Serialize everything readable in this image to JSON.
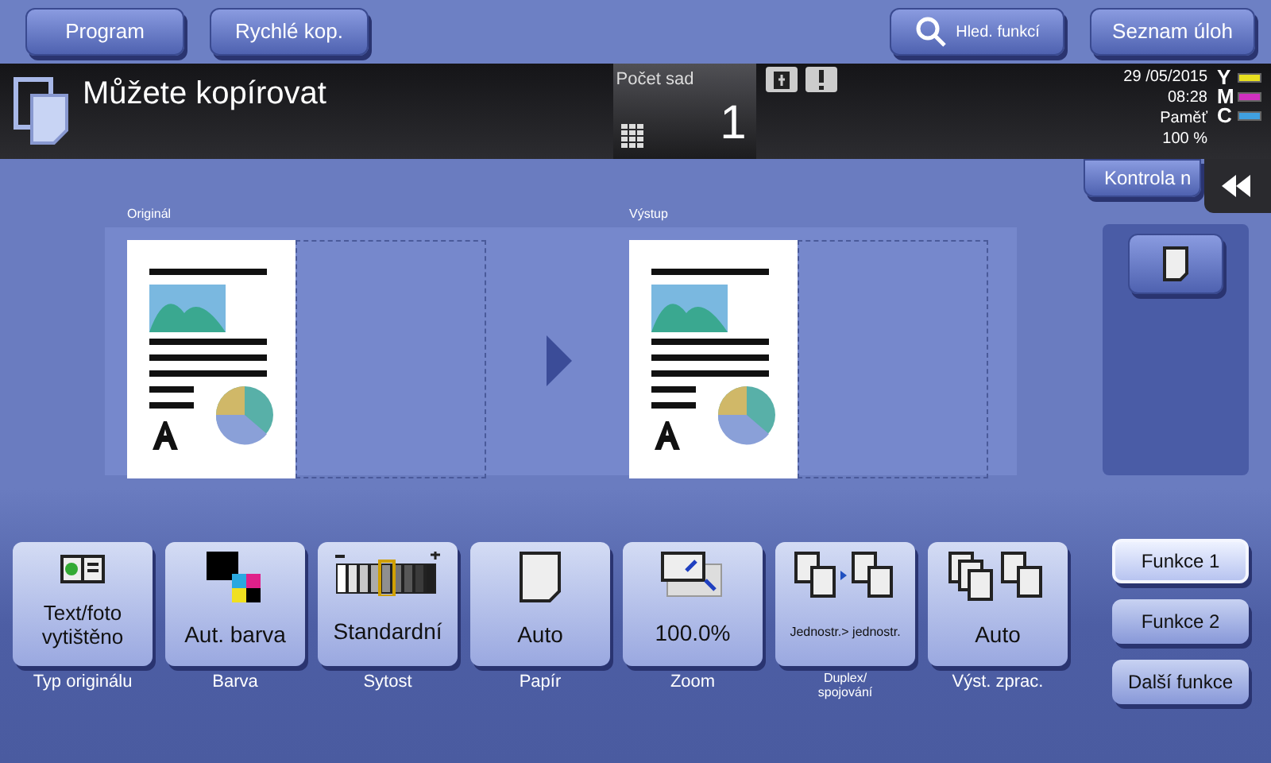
{
  "top_buttons": [
    {
      "label": "Program"
    },
    {
      "label": "Rychlé kop."
    }
  ],
  "search_button": {
    "label": "Hled. funkcí"
  },
  "jobs_button": {
    "label": "Seznam úloh"
  },
  "status": {
    "message": "Můžete kopírovat",
    "copies_label": "Počet sad",
    "copies": "1",
    "date": "29 /05/2015",
    "time": "08:28",
    "memory_label": "Paměť",
    "memory": "100 %"
  },
  "toners": [
    {
      "letter": "Y",
      "color": "#e8e020"
    },
    {
      "letter": "M",
      "color": "#d030c0"
    },
    {
      "letter": "C",
      "color": "#40a0e0"
    }
  ],
  "check_button": {
    "label": "Kontrola n"
  },
  "preview": {
    "original_label": "Originál",
    "output_label": "Výstup"
  },
  "functions": [
    {
      "kind": "original-type",
      "value": "Text/foto vytištěno",
      "caption": "Typ originálu"
    },
    {
      "kind": "color",
      "value": "Aut. barva",
      "caption": "Barva"
    },
    {
      "kind": "density",
      "value": "Standardní",
      "caption": "Sytost"
    },
    {
      "kind": "paper",
      "value": "Auto",
      "caption": "Papír"
    },
    {
      "kind": "zoom",
      "value": "100.0%",
      "caption": "Zoom"
    },
    {
      "kind": "duplex",
      "value": "Jednostr.> jednostr.",
      "caption": "Duplex/ spojování"
    },
    {
      "kind": "finishing",
      "value": "Auto",
      "caption": "Výst. zprac."
    }
  ],
  "side_tabs": [
    {
      "label": "Funkce 1",
      "selected": true
    },
    {
      "label": "Funkce 2",
      "selected": false
    },
    {
      "label": "Další funkce",
      "selected": false
    }
  ]
}
